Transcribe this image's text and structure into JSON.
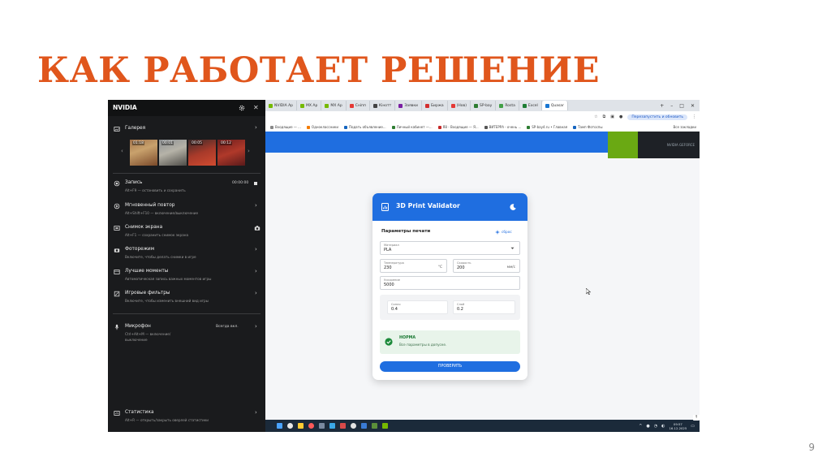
{
  "slide": {
    "title": "КАК РАБОТАЕТ РЕШЕНИЕ",
    "page_number": "9"
  },
  "nvidia": {
    "brand": "NVIDIA",
    "gallery": {
      "title": "Галерея",
      "thumbnails": [
        "01:18",
        "00:01",
        "00:05",
        "00:12"
      ]
    },
    "record": {
      "title": "Запись",
      "sub": "Alt+F9 — остановить и сохранить",
      "time": "00:00:00"
    },
    "instant_replay": {
      "title": "Мгновенный повтор",
      "sub": "Alt+Shift+F10 — включение/выключение"
    },
    "screenshot": {
      "title": "Снимок экрана",
      "sub": "Alt+F1 — сохранить снимок экрана"
    },
    "photo_mode": {
      "title": "Фоторежим",
      "sub": "Включите, чтобы делать снимки в игре"
    },
    "highlights": {
      "title": "Лучшие моменты",
      "sub": "Автоматическая запись важных моментов игры"
    },
    "game_filters": {
      "title": "Игровые фильтры",
      "sub": "Включите, чтобы изменить внешний вид игры"
    },
    "microphone": {
      "title": "Микрофон",
      "sub1": "Ctrl+Alt+M — включение/",
      "sub2": "выключение",
      "mode": "Всегда вкл."
    },
    "stats": {
      "title": "Статистика",
      "sub": "Alt+R — открыть/закрыть оверлей статистики"
    }
  },
  "browser": {
    "tabs": [
      {
        "label": "NVIDIA Ap",
        "color": "#76b900"
      },
      {
        "label": "MX Ap",
        "color": "#76b900"
      },
      {
        "label": "MX Ap",
        "color": "#76b900"
      },
      {
        "label": "Сніпп",
        "color": "#e53935"
      },
      {
        "label": "Кінотт",
        "color": "#444444"
      },
      {
        "label": "Заявки",
        "color": "#7b1fa2"
      },
      {
        "label": "Биржа",
        "color": "#d32f2f"
      },
      {
        "label": "(Нов)",
        "color": "#e53935"
      },
      {
        "label": "SP-bay",
        "color": "#2e7d32"
      },
      {
        "label": "Rosta",
        "color": "#43a047"
      },
      {
        "label": "Excel",
        "color": "#1e7e34"
      },
      {
        "label": "Quasar",
        "color": "#1976d2"
      }
    ],
    "relaunch_label": "Перезапустить и обновить",
    "bookmarks": [
      {
        "label": "Входящие — ...",
        "color": "#888888"
      },
      {
        "label": "Одноклассники",
        "color": "#f57c00"
      },
      {
        "label": "Подать объявление...",
        "color": "#1565c0"
      },
      {
        "label": "Личный кабинет —...",
        "color": "#2e7d32"
      },
      {
        "label": "Я8 - Входящие — Я...",
        "color": "#c62828"
      },
      {
        "label": "ВИТЕРРА - очень ...",
        "color": "#555555"
      },
      {
        "label": "SP-bay4.ru • Главная",
        "color": "#2e7d32"
      },
      {
        "label": "Тамп Фотоспы",
        "color": "#1565c0"
      }
    ],
    "bookmarks_all": "Все закладки",
    "overlay_text": "NVIDIA GEFORCE"
  },
  "card": {
    "title": "3D Print Validator",
    "params_title": "Параметры печати",
    "reset_label": "сброс",
    "material": {
      "label": "Материал",
      "value": "PLA"
    },
    "temperature": {
      "label": "Температура",
      "value": "230",
      "unit": "°C"
    },
    "speed": {
      "label": "Скорость",
      "value": "200",
      "unit": "мм/с"
    },
    "cooling": {
      "label": "Ускорение",
      "value": "5000"
    },
    "nozzle": {
      "label": "Сопло",
      "value": "0.4"
    },
    "layer": {
      "label": "Слой",
      "value": "0.2"
    },
    "status": {
      "title": "НОРМА",
      "sub": "Все параметры в допуске."
    },
    "check_button": "ПРОВЕРИТЬ"
  },
  "taskbar": {
    "time": "09:57",
    "date": "16.12.2025"
  },
  "colors": {
    "title": "#e0561c",
    "accent": "#1f6ee0",
    "nvidia_green": "#76b900",
    "ok": "#1c7a34"
  }
}
